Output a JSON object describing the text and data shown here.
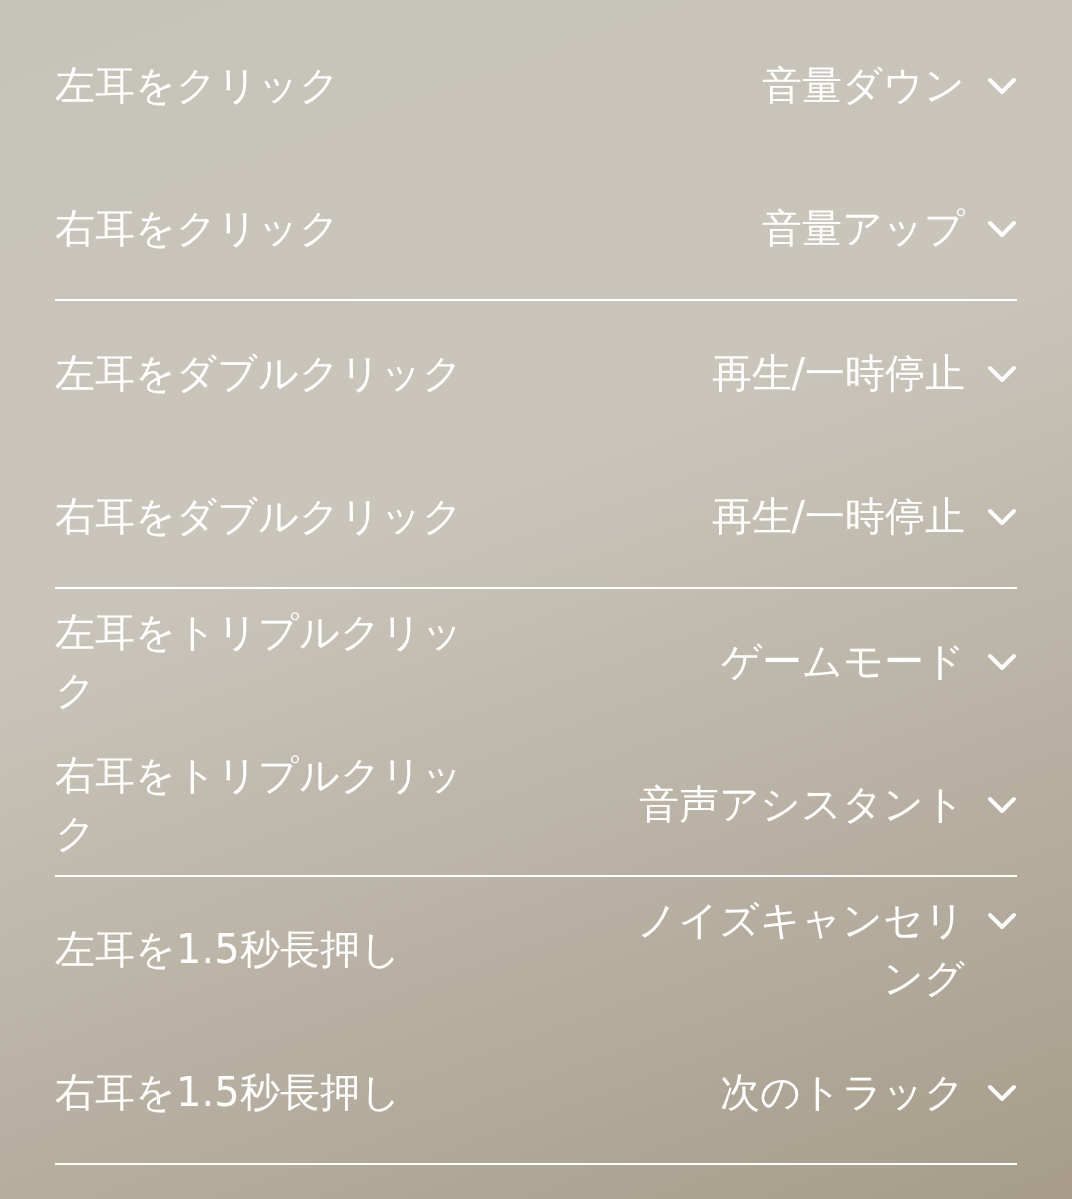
{
  "groups": [
    {
      "rows": [
        {
          "label": "左耳をクリック",
          "value": "音量ダウン"
        },
        {
          "label": "右耳をクリック",
          "value": "音量アップ"
        }
      ]
    },
    {
      "rows": [
        {
          "label": "左耳をダブルクリック",
          "value": "再生/一時停止"
        },
        {
          "label": "右耳をダブルクリック",
          "value": "再生/一時停止"
        }
      ]
    },
    {
      "rows": [
        {
          "label": "左耳をトリプルクリック",
          "value": "ゲームモード"
        },
        {
          "label": "右耳をトリプルクリック",
          "value": "音声アシスタント"
        }
      ]
    },
    {
      "rows": [
        {
          "label": "左耳を1.5秒長押し",
          "value": "ノイズキャンセリング"
        },
        {
          "label": "右耳を1.5秒長押し",
          "value": "次のトラック"
        }
      ]
    }
  ]
}
